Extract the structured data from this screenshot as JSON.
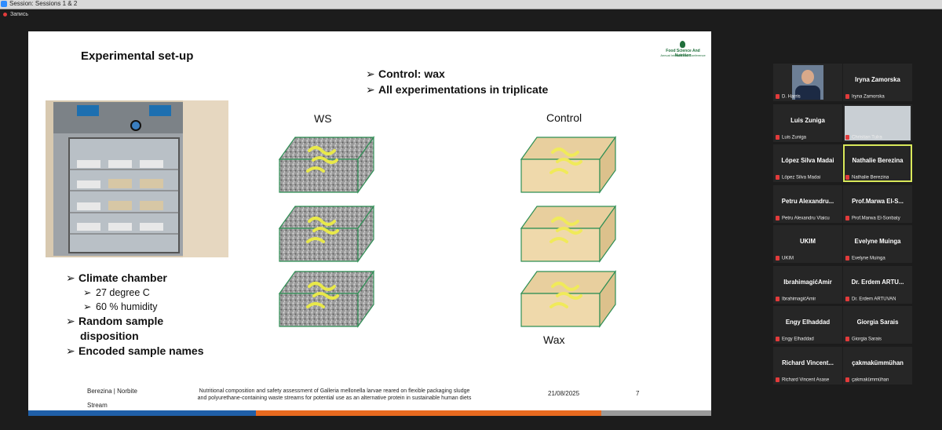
{
  "window": {
    "title": "Session: Sessions 1 & 2"
  },
  "recording": {
    "label": "Запись"
  },
  "slide": {
    "title": "Experimental set-up",
    "logo_line1": "Food Science And Nutrition",
    "logo_line2": "Annual International Conference",
    "bullets_top": [
      "Control: wax",
      "All experimentations in triplicate"
    ],
    "labels": {
      "ws": "WS",
      "control": "Control",
      "wax": "Wax"
    },
    "left_bullets": {
      "climate": "Climate chamber",
      "temp": "27 degree C",
      "humidity": "60 % humidity",
      "random_1": "Random sample",
      "random_2": "disposition",
      "encoded": "Encoded sample names"
    },
    "footer": {
      "author": "Berezina | Norbite",
      "stream": "Stream",
      "desc_1": "Nutritional composition and safety assessment of Galleria mellonella larvae reared on flexible packaging sludge",
      "desc_2": "and polyurethane-containing waste streams for potential use as an alternative protein in sustainable human diets",
      "date": "21/08/2025",
      "page": "7"
    },
    "bar_colors": [
      "#1f5fa8",
      "#e86a1f",
      "#9a9a9a"
    ]
  },
  "participants": [
    {
      "center": "",
      "sub": "D. Harris",
      "video": true,
      "active": false
    },
    {
      "center": "Iryna Zamorska",
      "sub": "Iryna Zamorska",
      "video": false,
      "active": false
    },
    {
      "center": "Luis Zuniga",
      "sub": "Luis Zuniga",
      "video": false,
      "active": false
    },
    {
      "center": "",
      "sub": "Christian Tulra",
      "video": true,
      "active": false
    },
    {
      "center": "López Silva Madai",
      "sub": "López Silva Madai",
      "video": false,
      "active": false
    },
    {
      "center": "Nathalie Berezina",
      "sub": "Nathalie Berezina",
      "video": false,
      "active": true
    },
    {
      "center": "Petru Alexandru...",
      "sub": "Petru Alexandru Vlaicu",
      "video": false,
      "active": false
    },
    {
      "center": "Prof.Marwa El-S...",
      "sub": "Prof.Marwa El-Sonbaty",
      "video": false,
      "active": false
    },
    {
      "center": "UKIM",
      "sub": "UKIM",
      "video": false,
      "active": false
    },
    {
      "center": "Evelyne Muinga",
      "sub": "Evelyne Muinga",
      "video": false,
      "active": false
    },
    {
      "center": "IbrahimagićAmir",
      "sub": "IbrahimagićAmir",
      "video": false,
      "active": false
    },
    {
      "center": "Dr. Erdem ARTU...",
      "sub": "Dr. Erdem ARTUVAN",
      "video": false,
      "active": false
    },
    {
      "center": "Engy Elhaddad",
      "sub": "Engy Elhaddad",
      "video": false,
      "active": false
    },
    {
      "center": "Giorgia Sarais",
      "sub": "Giorgia Sarais",
      "video": false,
      "active": false
    },
    {
      "center": "Richard Vincent...",
      "sub": "Richard Vincent Asase",
      "video": false,
      "active": false
    },
    {
      "center": "çakmakümmühan",
      "sub": "çakmakümmühan",
      "video": false,
      "active": false
    }
  ]
}
